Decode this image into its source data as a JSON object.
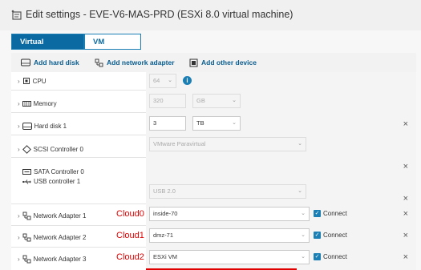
{
  "window": {
    "title": "Edit settings - EVE-V6-MAS-PRD (ESXi 8.0 virtual machine)"
  },
  "tabs": [
    {
      "label": "Virtual Hardware",
      "active": true
    },
    {
      "label": "VM Options",
      "active": false
    }
  ],
  "toolbar": {
    "add_hard_disk": "Add hard disk",
    "add_network_adapter": "Add network adapter",
    "add_other_device": "Add other device"
  },
  "hardware": {
    "cpu": {
      "label": "CPU",
      "value": "64"
    },
    "memory": {
      "label": "Memory",
      "value": "320",
      "unit": "GB"
    },
    "hard_disk": {
      "label": "Hard disk 1",
      "value": "3",
      "unit": "TB"
    },
    "scsi": {
      "label": "SCSI Controller 0",
      "value": "VMware Paravirtual"
    },
    "sata": {
      "label": "SATA Controller 0"
    },
    "usb": {
      "label": "USB controller 1",
      "value": "USB 2.0"
    },
    "network_adapters": [
      {
        "label": "Network Adapter 1",
        "cloud": "Cloud0",
        "network": "inside-70",
        "connect": "Connect"
      },
      {
        "label": "Network Adapter 2",
        "cloud": "Cloud1",
        "network": "dmz-71",
        "connect": "Connect"
      },
      {
        "label": "Network Adapter 3",
        "cloud": "Cloud2",
        "network": "ESXi VM",
        "connect": "Connect"
      }
    ]
  },
  "icons": {
    "title": "edit-settings-icon",
    "remove": "close-icon",
    "info": "info-icon"
  },
  "colors": {
    "accent": "#0b6aa2",
    "cloud_annotation": "#e00000"
  }
}
